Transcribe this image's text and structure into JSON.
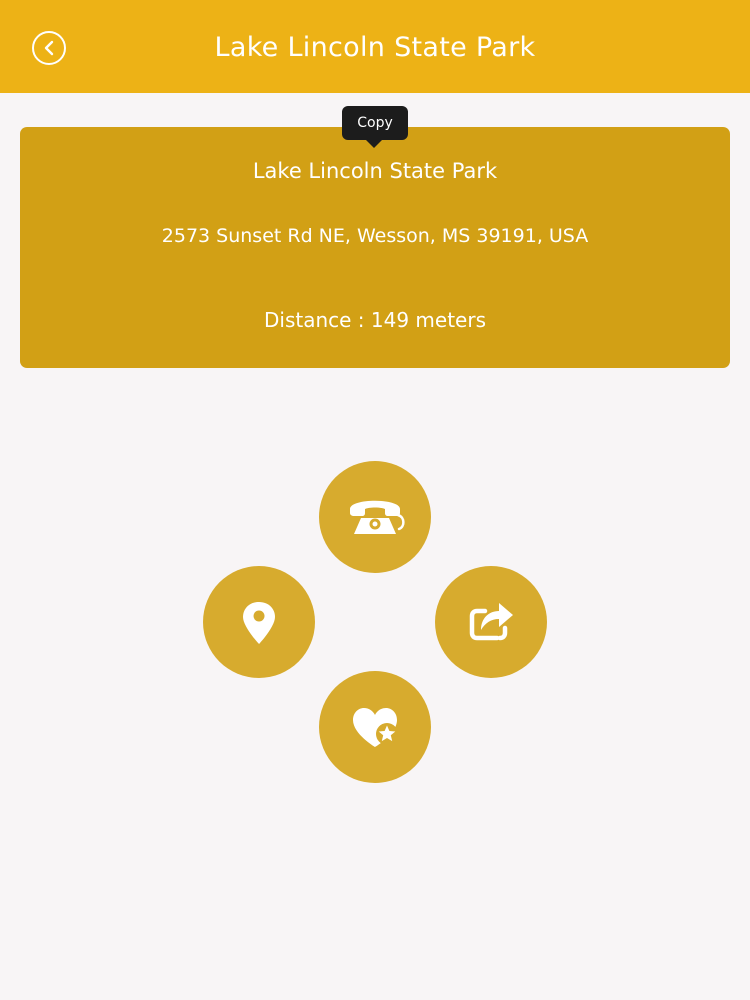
{
  "header": {
    "title": "Lake Lincoln State Park",
    "back_icon": "chevron-left-circle-icon"
  },
  "tooltip": {
    "label": "Copy"
  },
  "place": {
    "name": "Lake Lincoln State Park",
    "address": "2573 Sunset Rd NE, Wesson, MS 39191, USA",
    "distance": "Distance : 149 meters"
  },
  "actions": [
    {
      "id": "phone",
      "icon": "telephone-icon"
    },
    {
      "id": "location",
      "icon": "map-pin-icon"
    },
    {
      "id": "share",
      "icon": "share-icon"
    },
    {
      "id": "favorite",
      "icon": "heart-star-icon"
    }
  ],
  "colors": {
    "header": "#edb216",
    "card": "#d2a015",
    "action_button": "#d7ab2e",
    "background": "#f8f5f6",
    "tooltip": "#1c1c1c"
  }
}
